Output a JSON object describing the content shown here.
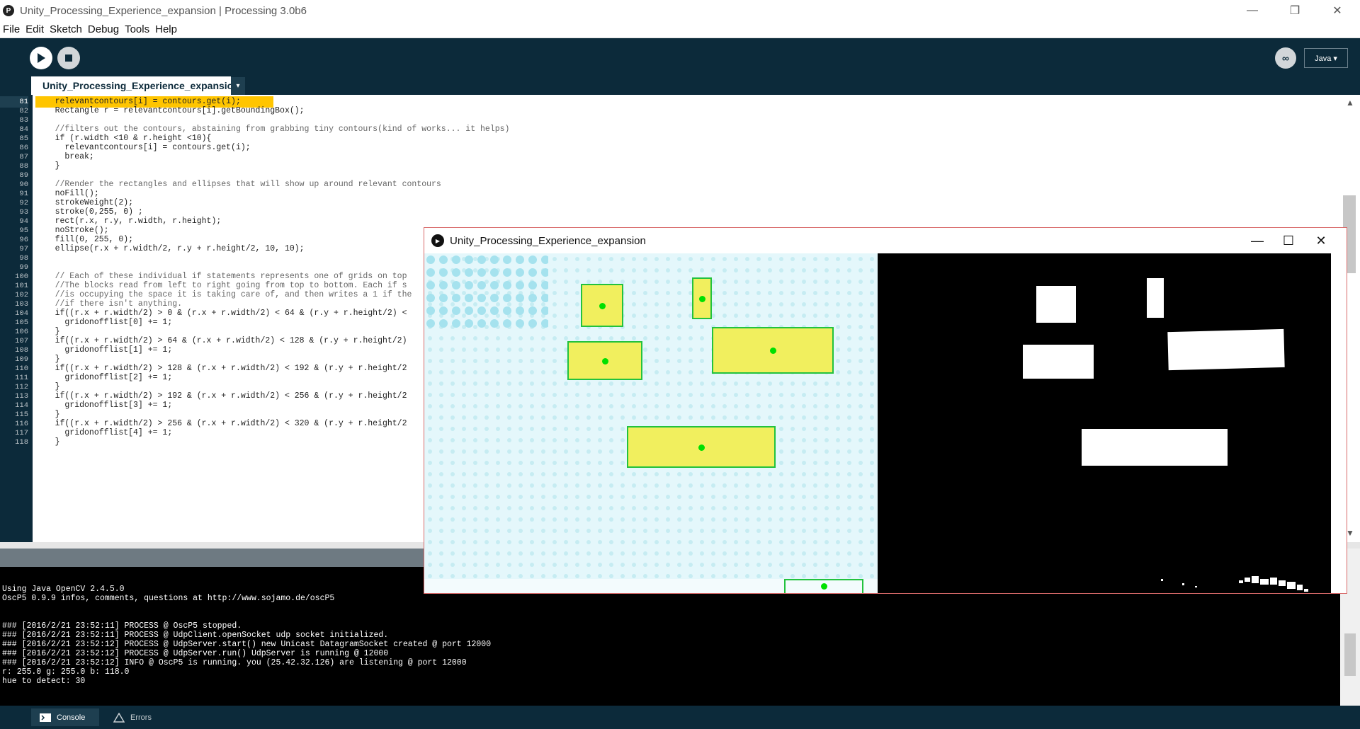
{
  "window": {
    "title": "Unity_Processing_Experience_expansion | Processing 3.0b6",
    "app_icon": "processing-logo-icon",
    "controls": [
      "—",
      "❐",
      "✕"
    ]
  },
  "menu": [
    "File",
    "Edit",
    "Sketch",
    "Debug",
    "Tools",
    "Help"
  ],
  "toolbar": {
    "run_icon": "play-icon",
    "stop_icon": "stop-icon",
    "debug_icon": "debugger-icon",
    "mode": "Java ▾"
  },
  "tab": {
    "label": "Unity_Processing_Experience_expansion",
    "arrow": "▾"
  },
  "editor": {
    "current_line": 81,
    "lines": [
      {
        "n": "81",
        "code": "    relevantcontours[i] = contours.get(i);"
      },
      {
        "n": "82",
        "code": "    Rectangle r = relevantcontours[i].getBoundingBox();"
      },
      {
        "n": "83",
        "code": ""
      },
      {
        "n": "84",
        "code": "    //filters out the contours, abstaining from grabbing tiny contours(kind of works... it helps)"
      },
      {
        "n": "85",
        "code": "    if (r.width <10 & r.height <10){"
      },
      {
        "n": "86",
        "code": "      relevantcontours[i] = contours.get(i);"
      },
      {
        "n": "87",
        "code": "      break;"
      },
      {
        "n": "88",
        "code": "    }"
      },
      {
        "n": "89",
        "code": ""
      },
      {
        "n": "90",
        "code": "    //Render the rectangles and ellipses that will show up around relevant contours"
      },
      {
        "n": "91",
        "code": "    noFill();"
      },
      {
        "n": "92",
        "code": "    strokeWeight(2);"
      },
      {
        "n": "93",
        "code": "    stroke(0,255, 0) ;"
      },
      {
        "n": "94",
        "code": "    rect(r.x, r.y, r.width, r.height);"
      },
      {
        "n": "95",
        "code": "    noStroke();"
      },
      {
        "n": "96",
        "code": "    fill(0, 255, 0);"
      },
      {
        "n": "97",
        "code": "    ellipse(r.x + r.width/2, r.y + r.height/2, 10, 10);"
      },
      {
        "n": "98",
        "code": ""
      },
      {
        "n": "99",
        "code": ""
      },
      {
        "n": "100",
        "code": "    // Each of these individual if statements represents one of grids on top"
      },
      {
        "n": "101",
        "code": "    //The blocks read from left to right going from top to bottom. Each if s"
      },
      {
        "n": "102",
        "code": "    //is occupying the space it is taking care of, and then writes a 1 if the"
      },
      {
        "n": "103",
        "code": "    //if there isn't anything."
      },
      {
        "n": "104",
        "code": "    if((r.x + r.width/2) > 0 & (r.x + r.width/2) < 64 & (r.y + r.height/2) <"
      },
      {
        "n": "105",
        "code": "      gridonofflist[0] += 1;"
      },
      {
        "n": "106",
        "code": "    }"
      },
      {
        "n": "107",
        "code": "    if((r.x + r.width/2) > 64 & (r.x + r.width/2) < 128 & (r.y + r.height/2)"
      },
      {
        "n": "108",
        "code": "      gridonofflist[1] += 1;"
      },
      {
        "n": "109",
        "code": "    }"
      },
      {
        "n": "110",
        "code": "    if((r.x + r.width/2) > 128 & (r.x + r.width/2) < 192 & (r.y + r.height/2"
      },
      {
        "n": "111",
        "code": "      gridonofflist[2] += 1;"
      },
      {
        "n": "112",
        "code": "    }"
      },
      {
        "n": "113",
        "code": "    if((r.x + r.width/2) > 192 & (r.x + r.width/2) < 256 & (r.y + r.height/2"
      },
      {
        "n": "114",
        "code": "      gridonofflist[3] += 1;"
      },
      {
        "n": "115",
        "code": "    }"
      },
      {
        "n": "116",
        "code": "    if((r.x + r.width/2) > 256 & (r.x + r.width/2) < 320 & (r.y + r.height/2"
      },
      {
        "n": "117",
        "code": "      gridonofflist[4] += 1;"
      },
      {
        "n": "118",
        "code": "    }"
      }
    ]
  },
  "console": {
    "lines": [
      "Using Java OpenCV 2.4.5.0",
      "OscP5 0.9.9 infos, comments, questions at http://www.sojamo.de/oscP5",
      "",
      "",
      "### [2016/2/21 23:52:11] PROCESS @ OscP5 stopped.",
      "### [2016/2/21 23:52:11] PROCESS @ UdpClient.openSocket udp socket initialized.",
      "### [2016/2/21 23:52:12] PROCESS @ UdpServer.start() new Unicast DatagramSocket created @ port 12000",
      "### [2016/2/21 23:52:12] PROCESS @ UdpServer.run() UdpServer is running @ 12000",
      "### [2016/2/21 23:52:12] INFO @ OscP5 is running. you (25.42.32.126) are listening @ port 12000",
      "r: 255.0 g: 255.0 b: 118.0",
      "hue to detect: 30"
    ]
  },
  "footer": {
    "console_label": "Console",
    "errors_label": "Errors",
    "console_icon": "terminal-icon",
    "errors_icon": "warning-icon"
  },
  "sketch_window": {
    "title": "Unity_Processing_Experience_expansion",
    "icon": "processing-run-icon",
    "controls": [
      "—",
      "☐",
      "✕"
    ]
  },
  "colors": {
    "toolbar": "#0c2a3a",
    "highlight": "#ffc500",
    "keyword": "#33997e",
    "function": "#006699",
    "field": "#d94a7a",
    "comment": "#666666",
    "detect_box": "#23c23e",
    "detect_fill": "#f1ef5e"
  }
}
